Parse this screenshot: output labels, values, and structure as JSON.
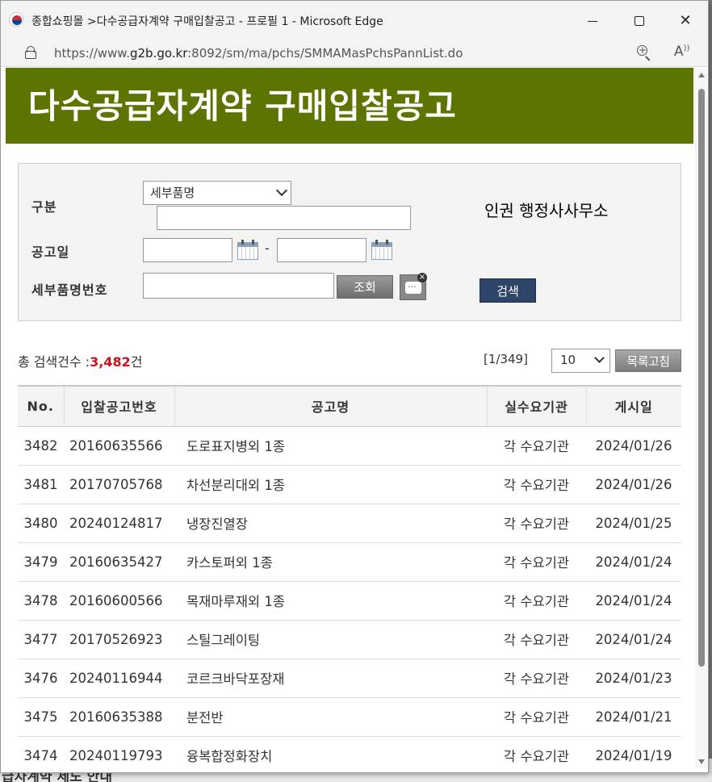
{
  "window": {
    "title": "종합쇼핑몰 >다수공급자계약 구매입찰공고 - 프로필 1 - Microsoft Edge",
    "url_prefix": "https://www.",
    "url_domain": "g2b.go.kr",
    "url_rest": ":8092/sm/ma/pchs/SMMAMasPchsPannList.do"
  },
  "banner": {
    "title": "다수공급자계약 구매입찰공고"
  },
  "search": {
    "category_label": "구분",
    "category_selected": "세부품명",
    "date_label": "공고일",
    "date_separator": "-",
    "item_no_label": "세부품명번호",
    "lookup_button": "조회",
    "search_button": "검색",
    "note": "인권 행정사사무소"
  },
  "summary": {
    "total_prefix": "총 검색건수 :",
    "total_count": "3,482",
    "total_suffix": "건",
    "page_indicator": "[1/349]",
    "page_size": "10",
    "refresh_button": "목록고침"
  },
  "table": {
    "headers": {
      "no": "No.",
      "bid_no": "입찰공고번호",
      "name": "공고명",
      "agency": "실수요기관",
      "date": "게시일"
    },
    "rows": [
      {
        "no": "3482",
        "bid_no": "20160635566",
        "name": "도로표지병외 1종",
        "agency": "각 수요기관",
        "date": "2024/01/26"
      },
      {
        "no": "3481",
        "bid_no": "20170705768",
        "name": "차선분리대외 1종",
        "agency": "각 수요기관",
        "date": "2024/01/26"
      },
      {
        "no": "3480",
        "bid_no": "20240124817",
        "name": "냉장진열장",
        "agency": "각 수요기관",
        "date": "2024/01/25"
      },
      {
        "no": "3479",
        "bid_no": "20160635427",
        "name": "카스토퍼외 1종",
        "agency": "각 수요기관",
        "date": "2024/01/24"
      },
      {
        "no": "3478",
        "bid_no": "20160600566",
        "name": "목재마루재외 1종",
        "agency": "각 수요기관",
        "date": "2024/01/24"
      },
      {
        "no": "3477",
        "bid_no": "20170526923",
        "name": "스틸그레이팅",
        "agency": "각 수요기관",
        "date": "2024/01/24"
      },
      {
        "no": "3476",
        "bid_no": "20240116944",
        "name": "코르크바닥포장재",
        "agency": "각 수요기관",
        "date": "2024/01/23"
      },
      {
        "no": "3475",
        "bid_no": "20160635388",
        "name": "분전반",
        "agency": "각 수요기관",
        "date": "2024/01/21"
      },
      {
        "no": "3474",
        "bid_no": "20240119793",
        "name": "융복합정화장치",
        "agency": "각 수요기관",
        "date": "2024/01/19"
      }
    ]
  },
  "background_page": {
    "partial_text": "급자계약 제도 안내"
  },
  "icons": {
    "logo": "korea-emblem-icon",
    "lock": "lock-icon",
    "zoom": "zoom-in-icon",
    "read_aloud": "read-aloud-icon",
    "calendar": "calendar-icon",
    "chat": "chat-icon"
  },
  "colors": {
    "banner": "#5c7400",
    "search_button": "#2e4469",
    "total_count": "#c4161c"
  }
}
